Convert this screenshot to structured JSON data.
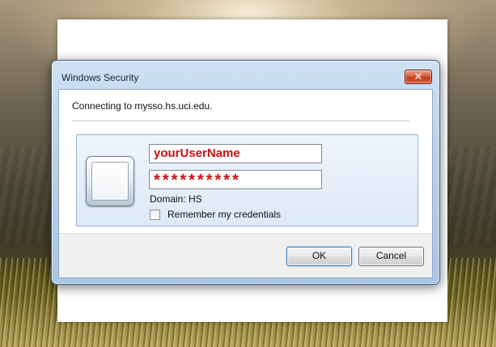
{
  "dialog": {
    "title": "Windows Security",
    "close_label": "✕",
    "message": "Connecting to mysso.hs.uci.edu.",
    "credentials": {
      "username": "yourUserName",
      "password_mask": "**********",
      "domain_label": "Domain: HS",
      "remember_label": "Remember my credentials",
      "remember_checked": false
    },
    "buttons": {
      "ok_label": "OK",
      "cancel_label": "Cancel"
    }
  },
  "icons": {
    "close": "close-icon",
    "user_tile": "user-tile-icon",
    "checkbox": "checkbox-icon"
  },
  "colors": {
    "field_text": "#cc1111",
    "window_frame": "#b9d2ea",
    "close_button": "#c23a1c"
  }
}
